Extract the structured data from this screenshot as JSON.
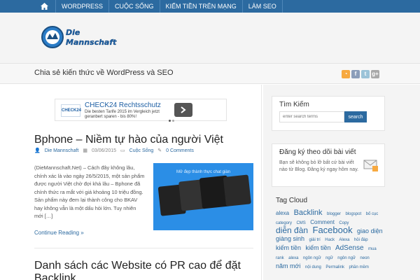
{
  "nav": {
    "items": [
      "WordPress",
      "Cuộc sống",
      "Kiếm tiền trên mạng",
      "Làm SEO"
    ]
  },
  "header": {
    "logo_text": "Die Mannschaft",
    "tagline": "Chia sẻ kiến thức về WordPress và SEO"
  },
  "ad": {
    "logo": "CHECK24",
    "title": "CHECK24 Rechtsschutz",
    "text": "Die besten Tarife 2015 im Vergleich jetzt geranbert sparen - bis 80%!"
  },
  "posts": [
    {
      "title": "Bphone – Niềm tự hào của người Việt",
      "author": "Die Mannschaft",
      "date": "03/06/2015",
      "category": "Cuộc Sống",
      "comments": "0 Comments",
      "excerpt": "(DieMannschaft.Net) – Cách đây không lâu, chính xác là vào ngày 26/5/2015, một sản phẩm được người Việt chờ đợi khá lâu – Bphone đã chính thức ra mắt với giá khoảng 10 triệu đồng. Sản phẩm này đem lại thành công cho BKAV hay không vẫn là một dấu hỏi lớn. Tuy nhiên mới […]",
      "thumb_title": "Mở đẹp thành thực chat giàn",
      "continue": "Continue Reading »"
    },
    {
      "title": "Danh sách các Website có PR cao để đặt Backlink"
    }
  ],
  "sidebar": {
    "search": {
      "title": "Tìm Kiếm",
      "placeholder": "enter search terms",
      "button": "search"
    },
    "subscribe": {
      "title": "Đăng ký theo dõi bài viết",
      "text": "Bạn sẽ không bỏ lỡ bất cứ bài viết nào từ Blog. Đăng ký ngay hôm nay."
    },
    "tagcloud": {
      "title": "Tag Cloud",
      "tags": [
        {
          "t": "alexa",
          "s": 8
        },
        {
          "t": "Backlink",
          "s": 11
        },
        {
          "t": "blogger",
          "s": 6
        },
        {
          "t": "blogspot",
          "s": 6
        },
        {
          "t": "bố cục",
          "s": 6
        },
        {
          "t": "category",
          "s": 6
        },
        {
          "t": "CMS",
          "s": 6
        },
        {
          "t": "Comment",
          "s": 8
        },
        {
          "t": "Copy",
          "s": 6
        },
        {
          "t": "diễn đàn",
          "s": 12
        },
        {
          "t": "Facebook",
          "s": 13
        },
        {
          "t": "giao diện",
          "s": 9
        },
        {
          "t": "giàng sinh",
          "s": 9
        },
        {
          "t": "giải trí",
          "s": 6
        },
        {
          "t": "Hack",
          "s": 6
        },
        {
          "t": "Alexa",
          "s": 6
        },
        {
          "t": "hỏi đáp",
          "s": 6
        },
        {
          "t": "kiếm tiền",
          "s": 9
        },
        {
          "t": "kiếm tiền",
          "s": 9
        },
        {
          "t": "AdSense",
          "s": 10
        },
        {
          "t": "mua",
          "s": 6
        },
        {
          "t": "rank",
          "s": 6
        },
        {
          "t": "alexa",
          "s": 6
        },
        {
          "t": "ngôn ngữ",
          "s": 6
        },
        {
          "t": "ngữ",
          "s": 6
        },
        {
          "t": "ngôn ngữ",
          "s": 6
        },
        {
          "t": "neon",
          "s": 6
        },
        {
          "t": "năm mới",
          "s": 9
        },
        {
          "t": "nội dung",
          "s": 6
        },
        {
          "t": "Permalink",
          "s": 6
        },
        {
          "t": "phần mềm",
          "s": 6
        }
      ]
    }
  },
  "colors": {
    "nav_bg": "#2c6aa0",
    "link": "#2c6aa0"
  }
}
